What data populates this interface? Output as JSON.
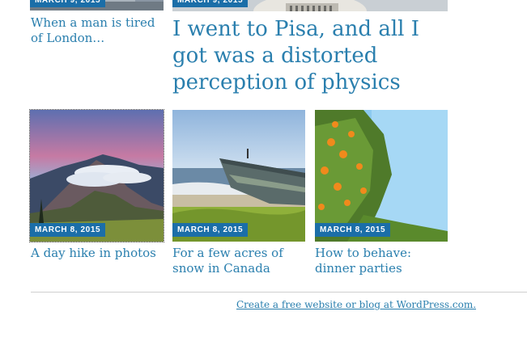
{
  "posts_top": [
    {
      "date": "MARCH 9, 2015",
      "title": "When a man is tired of London…"
    },
    {
      "date": "MARCH 9, 2015",
      "title": "I went to Pisa, and all I got was a distorted perception of physics"
    }
  ],
  "posts_grid": [
    {
      "date": "MARCH 8, 2015",
      "title": "A day hike in photos",
      "image": "volcano-sunset-photo"
    },
    {
      "date": "MARCH 8, 2015",
      "title": "For a few acres of snow in Canada",
      "image": "boat-on-beach-photo"
    },
    {
      "date": "MARCH 8, 2015",
      "title": "How to behave: dinner parties",
      "image": "orange-tree-photo"
    }
  ],
  "footer": {
    "link_text": "Create a free website or blog at WordPress.com."
  },
  "colors": {
    "link": "#2a7fae",
    "badge": "#1b6ea8"
  }
}
